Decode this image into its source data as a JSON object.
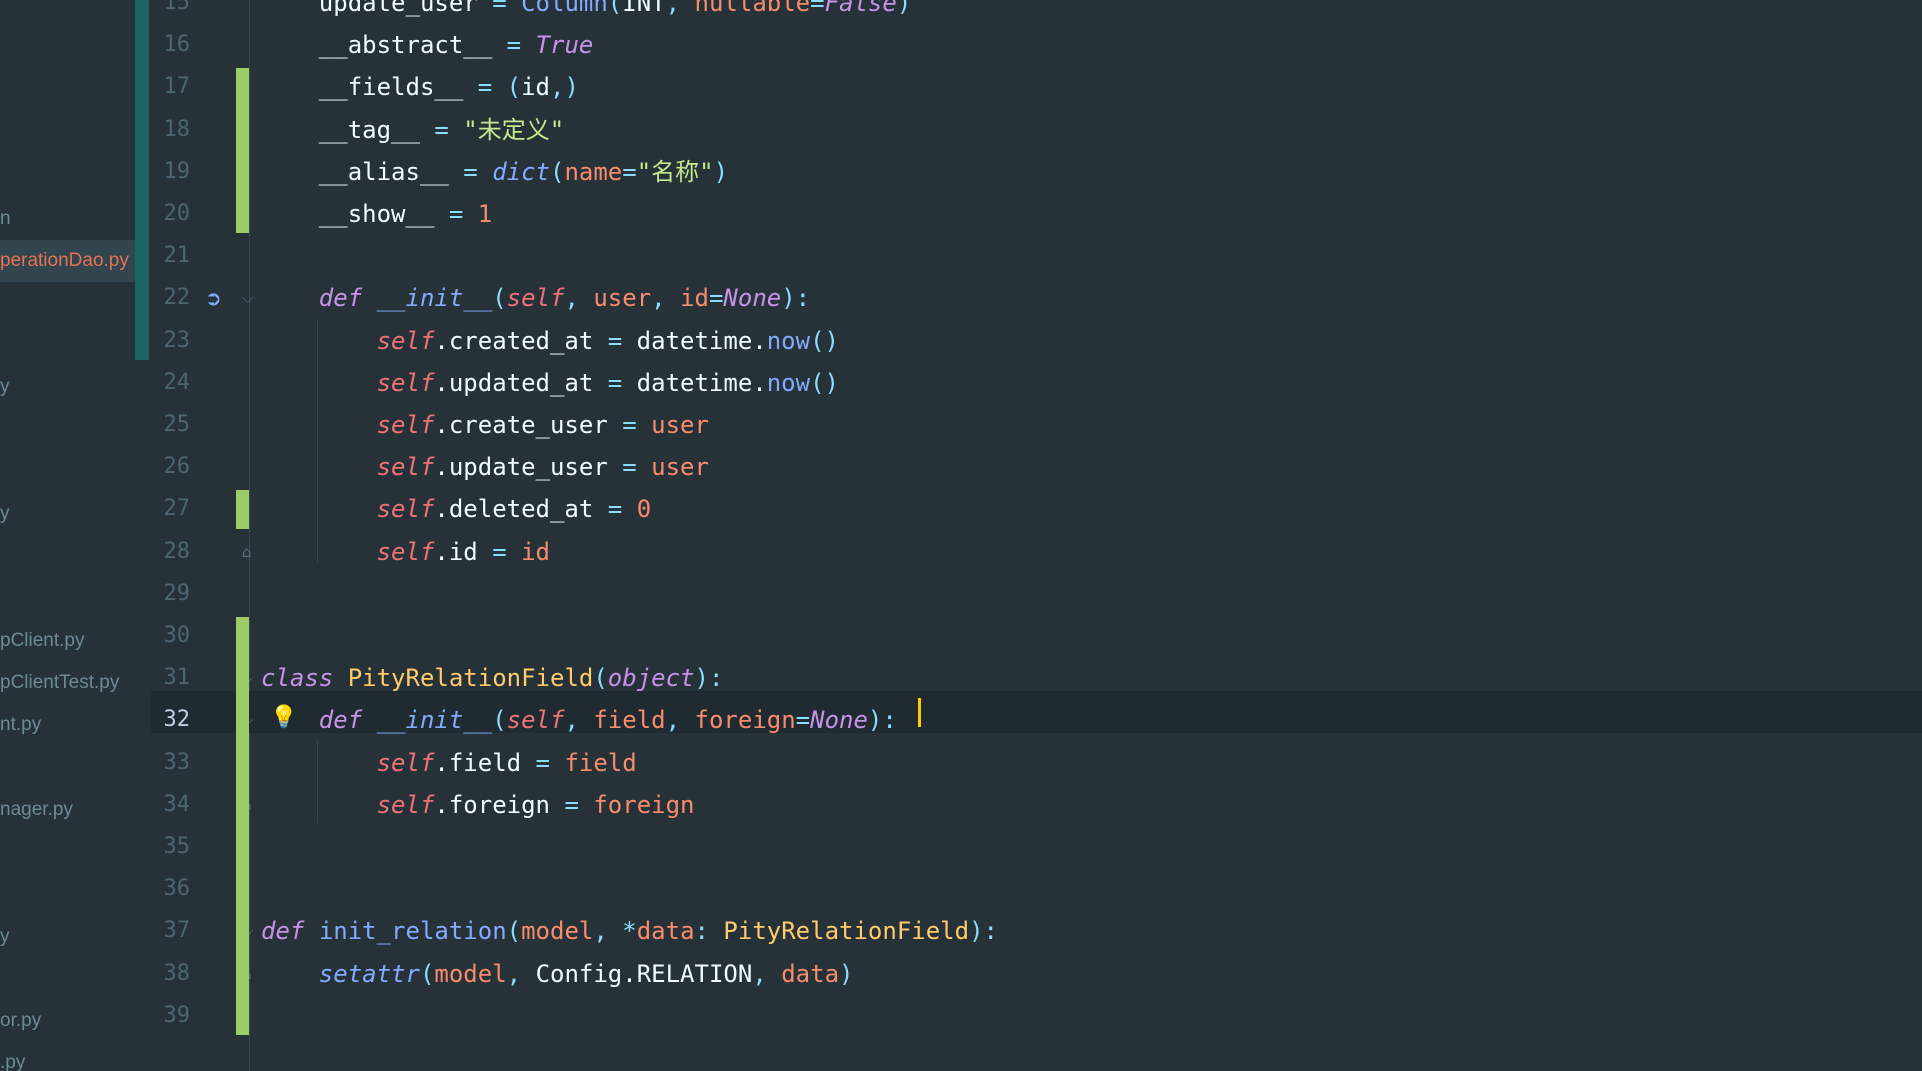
{
  "sidebar": {
    "files": [
      {
        "label": "n",
        "active": false
      },
      {
        "label": "perationDao.py",
        "active": true
      },
      {
        "label": "y",
        "active": false
      },
      {
        "label": "y",
        "active": false
      },
      {
        "label": "pClient.py",
        "active": false
      },
      {
        "label": "pClientTest.py",
        "active": false
      },
      {
        "label": "nt.py",
        "active": false
      },
      {
        "label": "nager.py",
        "active": false
      },
      {
        "label": "y",
        "active": false
      },
      {
        "label": "or.py",
        "active": false
      },
      {
        ".py": null,
        "label": ".py",
        "active": false
      }
    ]
  },
  "editor": {
    "current_line": 32,
    "lines": [
      {
        "n": "15",
        "tokens": [
          [
            "plain",
            "    update_user "
          ],
          [
            "op",
            "="
          ],
          [
            "plain",
            " "
          ],
          [
            "fn",
            "Column"
          ],
          [
            "punc",
            "("
          ],
          [
            "plain",
            "INT"
          ],
          [
            "punc",
            ", "
          ],
          [
            "par",
            "nullable"
          ],
          [
            "op",
            "="
          ],
          [
            "const",
            "False"
          ],
          [
            "punc",
            ")"
          ]
        ]
      },
      {
        "n": "16",
        "tokens": [
          [
            "plain",
            "    __abstract__ "
          ],
          [
            "op",
            "="
          ],
          [
            "plain",
            " "
          ],
          [
            "const",
            "True"
          ]
        ]
      },
      {
        "n": "17",
        "tokens": [
          [
            "plain",
            "    __fields__ "
          ],
          [
            "op",
            "="
          ],
          [
            "plain",
            " "
          ],
          [
            "punc",
            "("
          ],
          [
            "plain",
            "id"
          ],
          [
            "punc",
            ",)"
          ]
        ]
      },
      {
        "n": "18",
        "tokens": [
          [
            "plain",
            "    __tag__ "
          ],
          [
            "op",
            "="
          ],
          [
            "plain",
            " "
          ],
          [
            "str",
            "\"未定义\""
          ]
        ]
      },
      {
        "n": "19",
        "tokens": [
          [
            "plain",
            "    __alias__ "
          ],
          [
            "op",
            "="
          ],
          [
            "plain",
            " "
          ],
          [
            "fnc",
            "dict"
          ],
          [
            "punc",
            "("
          ],
          [
            "par",
            "name"
          ],
          [
            "op",
            "="
          ],
          [
            "str",
            "\"名称\""
          ],
          [
            "punc",
            ")"
          ]
        ]
      },
      {
        "n": "20",
        "tokens": [
          [
            "plain",
            "    __show__ "
          ],
          [
            "op",
            "="
          ],
          [
            "plain",
            " "
          ],
          [
            "num",
            "1"
          ]
        ]
      },
      {
        "n": "21",
        "tokens": []
      },
      {
        "n": "22",
        "tokens": [
          [
            "plain",
            "    "
          ],
          [
            "kw",
            "def"
          ],
          [
            "plain",
            " "
          ],
          [
            "fnc",
            "__init__"
          ],
          [
            "punc",
            "("
          ],
          [
            "slf",
            "self"
          ],
          [
            "punc",
            ", "
          ],
          [
            "par",
            "user"
          ],
          [
            "punc",
            ", "
          ],
          [
            "par",
            "id"
          ],
          [
            "op",
            "="
          ],
          [
            "const",
            "None"
          ],
          [
            "punc",
            "):"
          ]
        ]
      },
      {
        "n": "23",
        "tokens": [
          [
            "plain",
            "        "
          ],
          [
            "slf",
            "self"
          ],
          [
            "plain",
            ".created_at "
          ],
          [
            "op",
            "="
          ],
          [
            "plain",
            " datetime."
          ],
          [
            "fn",
            "now"
          ],
          [
            "punc",
            "()"
          ]
        ]
      },
      {
        "n": "24",
        "tokens": [
          [
            "plain",
            "        "
          ],
          [
            "slf",
            "self"
          ],
          [
            "plain",
            ".updated_at "
          ],
          [
            "op",
            "="
          ],
          [
            "plain",
            " datetime."
          ],
          [
            "fn",
            "now"
          ],
          [
            "punc",
            "()"
          ]
        ]
      },
      {
        "n": "25",
        "tokens": [
          [
            "plain",
            "        "
          ],
          [
            "slf",
            "self"
          ],
          [
            "plain",
            ".create_user "
          ],
          [
            "op",
            "="
          ],
          [
            "plain",
            " "
          ],
          [
            "par",
            "user"
          ]
        ]
      },
      {
        "n": "26",
        "tokens": [
          [
            "plain",
            "        "
          ],
          [
            "slf",
            "self"
          ],
          [
            "plain",
            ".update_user "
          ],
          [
            "op",
            "="
          ],
          [
            "plain",
            " "
          ],
          [
            "par",
            "user"
          ]
        ]
      },
      {
        "n": "27",
        "tokens": [
          [
            "plain",
            "        "
          ],
          [
            "slf",
            "self"
          ],
          [
            "plain",
            ".deleted_at "
          ],
          [
            "op",
            "="
          ],
          [
            "plain",
            " "
          ],
          [
            "num",
            "0"
          ]
        ]
      },
      {
        "n": "28",
        "tokens": [
          [
            "plain",
            "        "
          ],
          [
            "slf",
            "self"
          ],
          [
            "plain",
            ".id "
          ],
          [
            "op",
            "="
          ],
          [
            "plain",
            " "
          ],
          [
            "par",
            "id"
          ]
        ]
      },
      {
        "n": "29",
        "tokens": []
      },
      {
        "n": "30",
        "tokens": []
      },
      {
        "n": "31",
        "tokens": [
          [
            "kw",
            "class"
          ],
          [
            "plain",
            " "
          ],
          [
            "cls",
            "PityRelationField"
          ],
          [
            "punc",
            "("
          ],
          [
            "const",
            "object"
          ],
          [
            "punc",
            "):"
          ]
        ]
      },
      {
        "n": "32",
        "tokens": [
          [
            "plain",
            "    "
          ],
          [
            "kw",
            "def"
          ],
          [
            "plain",
            " "
          ],
          [
            "fnc",
            "__init__"
          ],
          [
            "punc",
            "("
          ],
          [
            "slf",
            "self"
          ],
          [
            "punc",
            ", "
          ],
          [
            "par",
            "field"
          ],
          [
            "punc",
            ", "
          ],
          [
            "par",
            "foreign"
          ],
          [
            "op",
            "="
          ],
          [
            "const",
            "None"
          ],
          [
            "punc",
            "):"
          ]
        ]
      },
      {
        "n": "33",
        "tokens": [
          [
            "plain",
            "        "
          ],
          [
            "slf",
            "self"
          ],
          [
            "plain",
            ".field "
          ],
          [
            "op",
            "="
          ],
          [
            "plain",
            " "
          ],
          [
            "par",
            "field"
          ]
        ]
      },
      {
        "n": "34",
        "tokens": [
          [
            "plain",
            "        "
          ],
          [
            "slf",
            "self"
          ],
          [
            "plain",
            ".foreign "
          ],
          [
            "op",
            "="
          ],
          [
            "plain",
            " "
          ],
          [
            "par",
            "foreign"
          ]
        ]
      },
      {
        "n": "35",
        "tokens": []
      },
      {
        "n": "36",
        "tokens": []
      },
      {
        "n": "37",
        "tokens": [
          [
            "kw",
            "def"
          ],
          [
            "plain",
            " "
          ],
          [
            "fn",
            "init_relation"
          ],
          [
            "punc",
            "("
          ],
          [
            "par",
            "model"
          ],
          [
            "punc",
            ", "
          ],
          [
            "op",
            "*"
          ],
          [
            "par",
            "data"
          ],
          [
            "punc",
            ": "
          ],
          [
            "cls",
            "PityRelationField"
          ],
          [
            "punc",
            "):"
          ]
        ]
      },
      {
        "n": "38",
        "tokens": [
          [
            "plain",
            "    "
          ],
          [
            "fnc",
            "setattr"
          ],
          [
            "punc",
            "("
          ],
          [
            "par",
            "model"
          ],
          [
            "punc",
            ", "
          ],
          [
            "plain",
            "Config.RELATION"
          ],
          [
            "punc",
            ", "
          ],
          [
            "par",
            "data"
          ],
          [
            "punc",
            ")"
          ]
        ]
      },
      {
        "n": "39",
        "tokens": []
      }
    ]
  },
  "gutter_icons": {
    "override_icon": "override-method-icon",
    "intention_icon": "lightbulb-icon"
  },
  "colors": {
    "background": "#263238",
    "vcs_modified": "#9ccc65",
    "caret": "#ffcc00",
    "active_file": "#e27355"
  }
}
